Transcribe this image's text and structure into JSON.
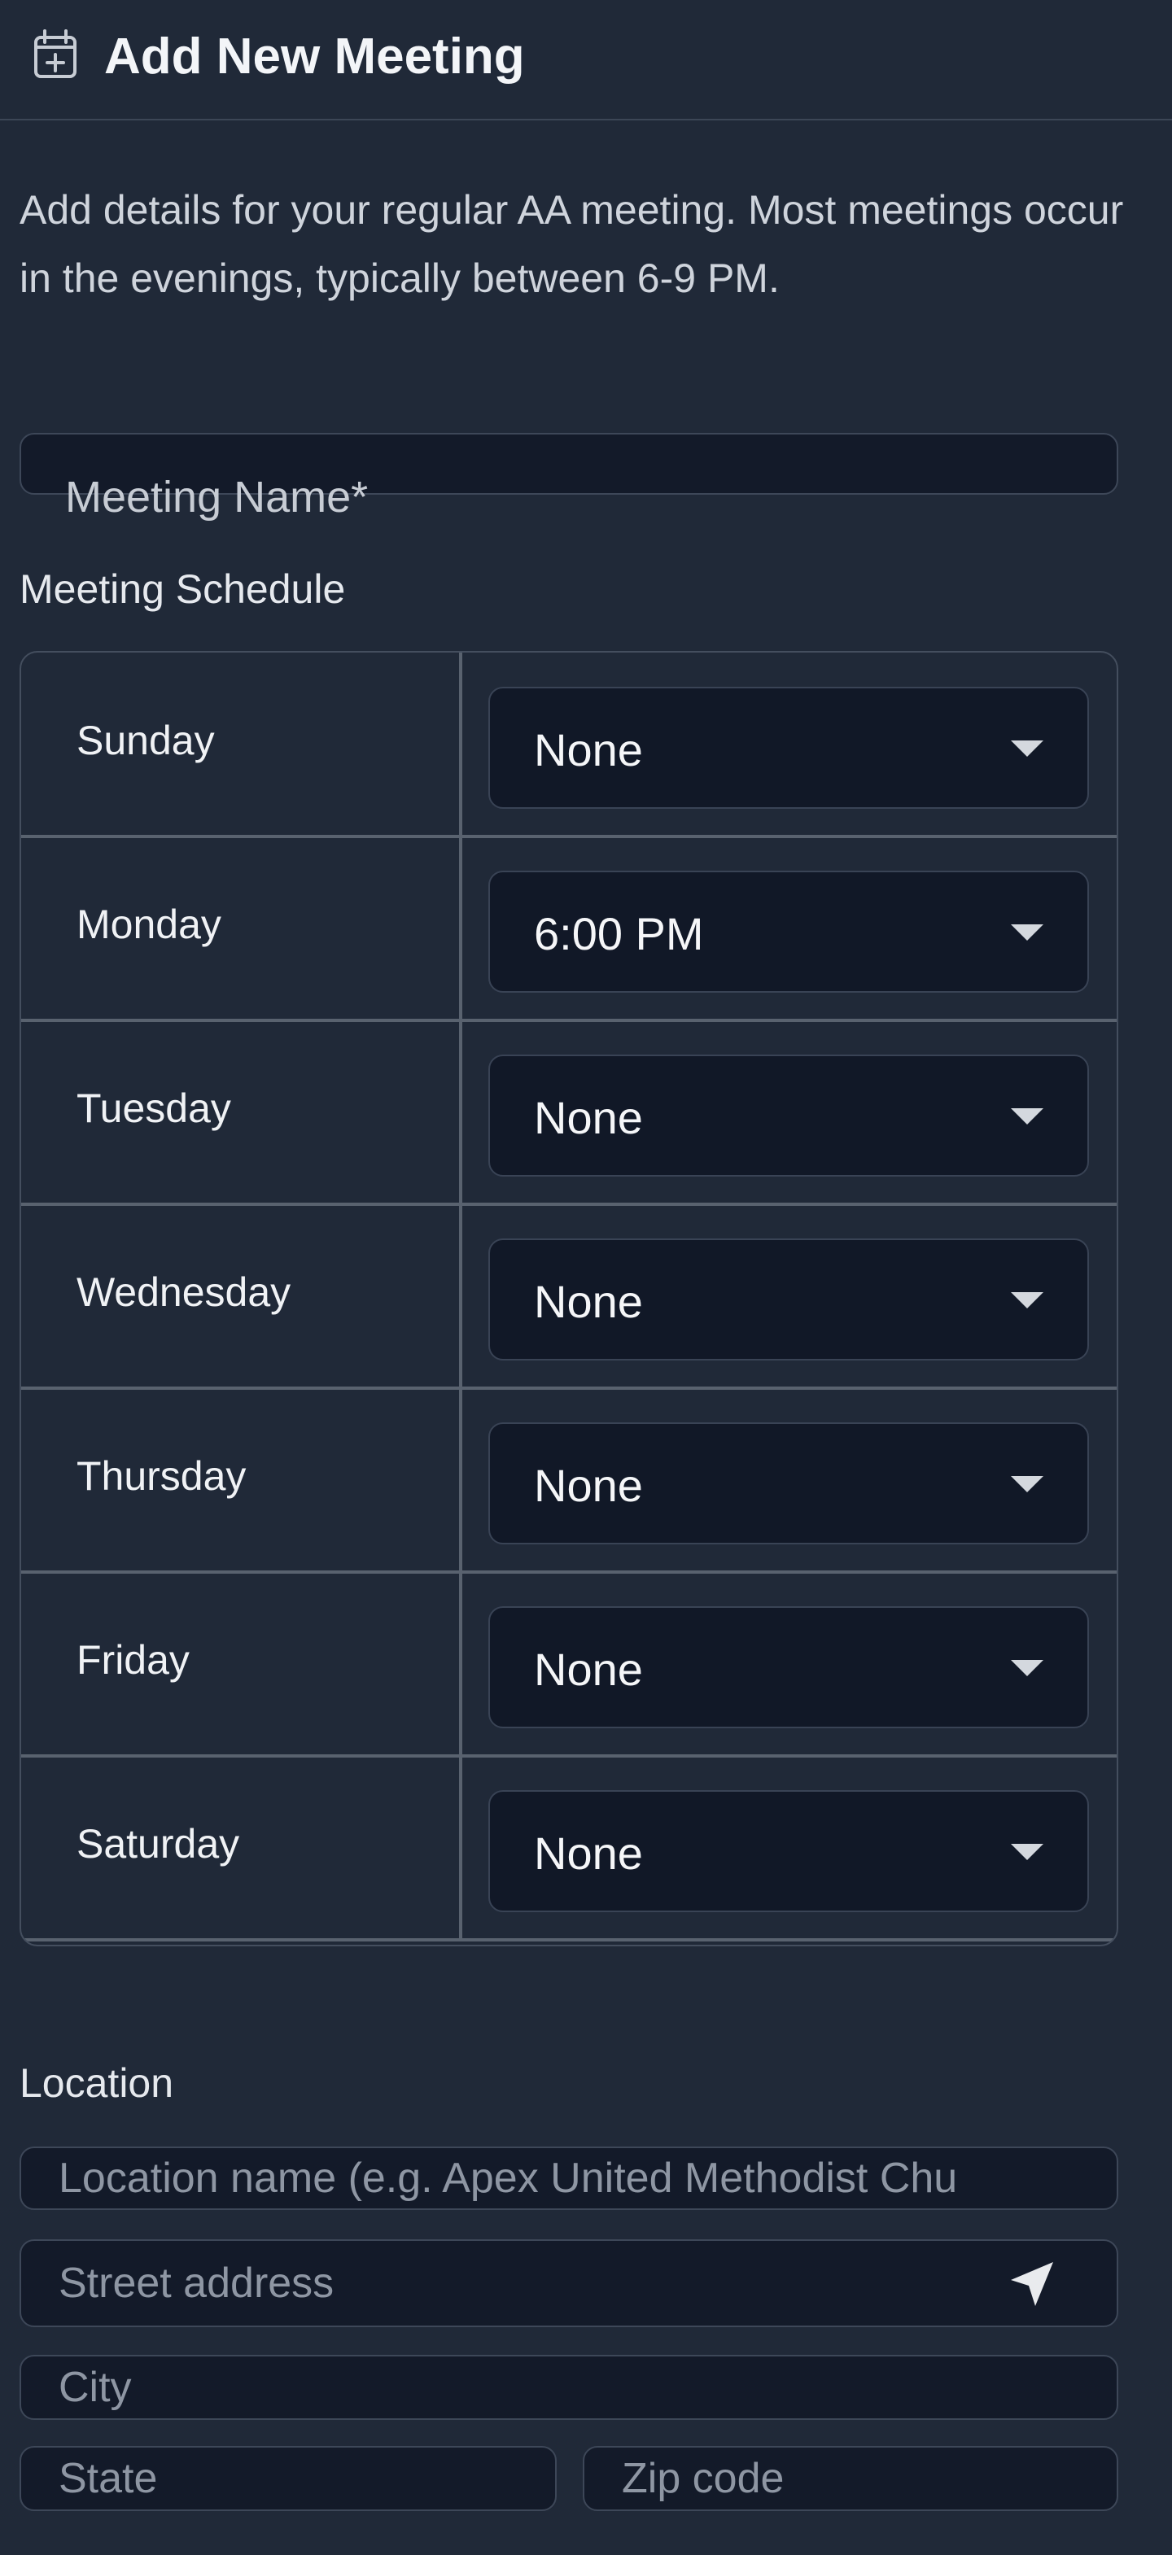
{
  "header": {
    "title": "Add New Meeting",
    "icon": "calendar-add-icon"
  },
  "intro": {
    "text": "Add details for your regular AA meeting. Most meetings occur in the evenings, typically between 6-9 PM."
  },
  "meeting_name": {
    "label": "Meeting Name*",
    "value": ""
  },
  "schedule": {
    "heading": "Meeting Schedule",
    "rows": [
      {
        "day": "Sunday",
        "time": "None"
      },
      {
        "day": "Monday",
        "time": "6:00 PM"
      },
      {
        "day": "Tuesday",
        "time": "None"
      },
      {
        "day": "Wednesday",
        "time": "None"
      },
      {
        "day": "Thursday",
        "time": "None"
      },
      {
        "day": "Friday",
        "time": "None"
      },
      {
        "day": "Saturday",
        "time": "None"
      }
    ]
  },
  "location": {
    "heading": "Location",
    "name_placeholder": "Location name (e.g. Apex United Methodist Chu",
    "street_placeholder": "Street address",
    "city_placeholder": "City",
    "state_placeholder": "State",
    "zip_placeholder": "Zip code",
    "street_icon": "navigation-arrow-icon"
  },
  "colors": {
    "background": "#202938",
    "input_background": "#111827",
    "border": "#59626f",
    "text": "#e6e9ee",
    "placeholder": "#8e96a3"
  }
}
